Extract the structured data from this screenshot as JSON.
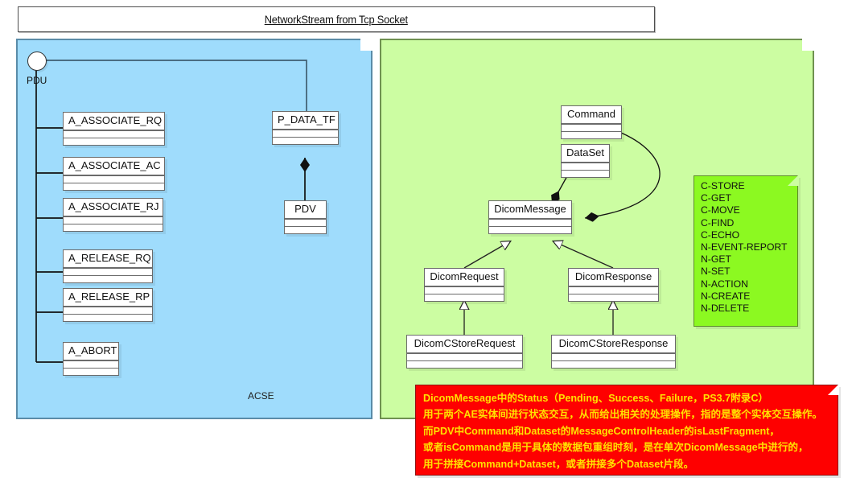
{
  "diagram": {
    "title": "NetworkStream from Tcp Socket",
    "colors": {
      "acse_package": "#9fdcfc",
      "dicom_package": "#ccfda2",
      "service_note": "#8cf921",
      "status_note_bg": "#fe0000",
      "status_note_text": "#ffe100"
    }
  },
  "acse_package": {
    "label": "ACSE",
    "interface": {
      "name": "PDU"
    },
    "classes": [
      {
        "name": "A_ASSOCIATE_RQ"
      },
      {
        "name": "A_ASSOCIATE_AC"
      },
      {
        "name": "A_ASSOCIATE_RJ"
      },
      {
        "name": "A_RELEASE_RQ"
      },
      {
        "name": "A_RELEASE_RP"
      },
      {
        "name": "A_ABORT"
      },
      {
        "name": "P_DATA_TF"
      },
      {
        "name": "PDV"
      }
    ]
  },
  "dicom_package": {
    "classes": [
      {
        "name": "Command"
      },
      {
        "name": "DataSet"
      },
      {
        "name": "DicomMessage"
      },
      {
        "name": "DicomRequest"
      },
      {
        "name": "DicomResponse"
      },
      {
        "name": "DicomCStoreRequest"
      },
      {
        "name": "DicomCStoreResponse"
      }
    ]
  },
  "service_note": {
    "items": [
      "C-STORE",
      "C-GET",
      "C-MOVE",
      "C-FIND",
      "C-ECHO",
      "N-EVENT-REPORT",
      "N-GET",
      "N-SET",
      "N-ACTION",
      "N-CREATE",
      "N-DELETE"
    ]
  },
  "status_note": {
    "lines": [
      "DicomMessage中的Status（Pending、Success、Failure，PS3.7附录C）",
      "用于两个AE实体间进行状态交互，从而给出相关的处理操作，指的是整个实体交互操作。",
      "而PDV中Command和Dataset的MessageControlHeader的isLastFragment，",
      "或者isCommand是用于具体的数据包重组时刻，是在单次DicomMessage中进行的，",
      "用于拼接Command+Dataset，或者拼接多个Dataset片段。"
    ]
  }
}
